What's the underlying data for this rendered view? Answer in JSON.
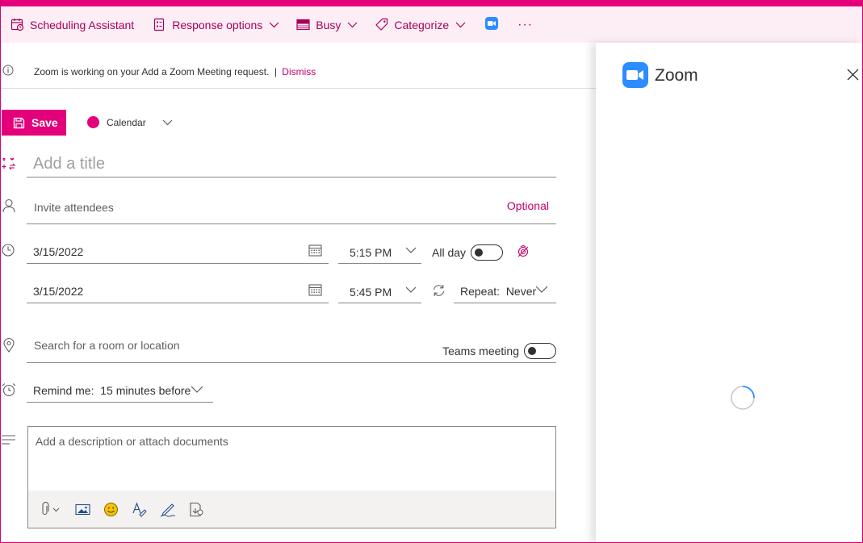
{
  "colors": {
    "accent": "#e3007a",
    "accent_text": "#a8005a",
    "toolbar_bg": "#fdeef5",
    "zoom_blue": "#2d8cff"
  },
  "toolbar": {
    "items": [
      {
        "label": "Scheduling Assistant",
        "icon": "calendar-clock-icon",
        "dropdown": false
      },
      {
        "label": "Response options",
        "icon": "response-icon",
        "dropdown": true
      },
      {
        "label": "Busy",
        "icon": "busy-status-icon",
        "dropdown": true
      },
      {
        "label": "Categorize",
        "icon": "tag-icon",
        "dropdown": true
      }
    ],
    "zoom_icon": "zoom-app-icon",
    "more": "···"
  },
  "info_bar": {
    "icon": "info-icon",
    "message": "Zoom is working on your Add a Zoom Meeting request.",
    "separator": "|",
    "dismiss": "Dismiss"
  },
  "form": {
    "save_label": "Save",
    "calendar_label": "Calendar",
    "title_placeholder": "Add a title",
    "attendees_placeholder": "Invite attendees",
    "optional_label": "Optional",
    "start_date": "3/15/2022",
    "start_time": "5:15 PM",
    "end_date": "3/15/2022",
    "end_time": "5:45 PM",
    "all_day_label": "All day",
    "all_day_on": false,
    "repeat_label": "Repeat:  Never",
    "location_placeholder": "Search for a room or location",
    "teams_label": "Teams meeting",
    "teams_on": false,
    "remind_label": "Remind me:  15 minutes before",
    "description_placeholder": "Add a description or attach documents",
    "desc_tools": [
      "attach-icon",
      "image-icon",
      "emoji-icon",
      "format-text-icon",
      "signature-icon",
      "insert-icon"
    ]
  },
  "zoom_panel": {
    "title": "Zoom",
    "loading": true
  }
}
